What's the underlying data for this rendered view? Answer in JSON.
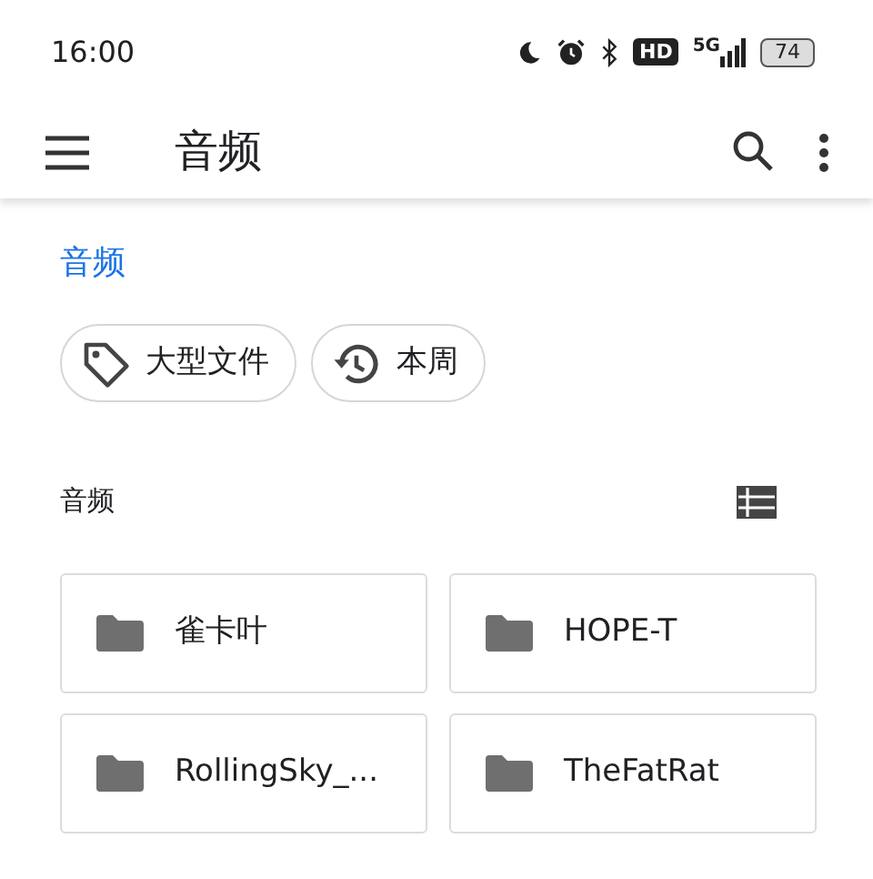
{
  "status_bar": {
    "time": "16:00",
    "hd": "HD",
    "network": "5G",
    "battery": "74"
  },
  "toolbar": {
    "title": "音频"
  },
  "breadcrumb": "音频",
  "chips": [
    {
      "kind": "tag",
      "label": "大型文件"
    },
    {
      "kind": "history",
      "label": "本周"
    }
  ],
  "section": {
    "title": "音频"
  },
  "folders": [
    {
      "name": "雀卡叶"
    },
    {
      "name": "HOPE-T"
    },
    {
      "name": "RollingSky_..."
    },
    {
      "name": "TheFatRat"
    }
  ]
}
